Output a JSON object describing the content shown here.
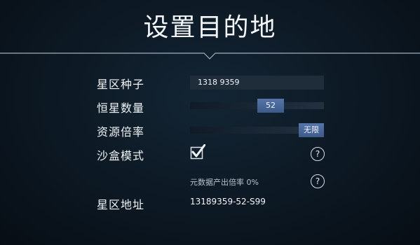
{
  "title": "设置目的地",
  "rows": {
    "seed": {
      "label": "星区种子",
      "value": "1318 9359"
    },
    "star_count": {
      "label": "恒星数量",
      "value": "52",
      "level": 0.61
    },
    "resource": {
      "label": "资源倍率",
      "value": "无限",
      "level": 1.0
    },
    "sandbox": {
      "label": "沙盒模式",
      "checked": true
    },
    "metadata": {
      "text": "元数据产出倍率 0%"
    },
    "address": {
      "label": "星区地址",
      "value": "13189359-52-S99"
    }
  },
  "icons": {
    "help": "?",
    "checkbox": "checkmark-icon"
  },
  "colors": {
    "accent": "#4a6899",
    "background": "#0c1823"
  }
}
